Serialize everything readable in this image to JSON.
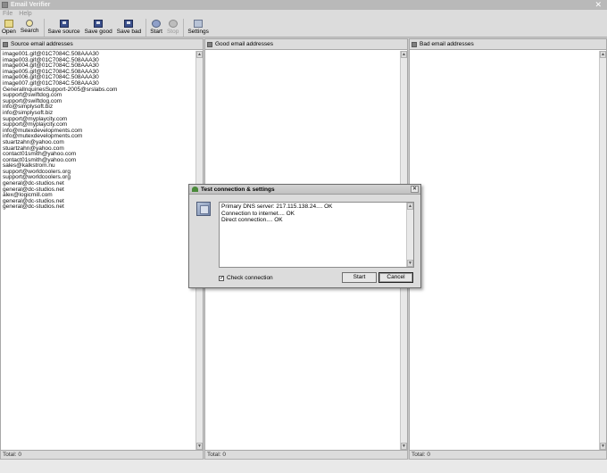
{
  "window": {
    "title": "Email Verifier"
  },
  "menu": [
    "File",
    "Help"
  ],
  "toolbar": [
    {
      "label": "Open",
      "icon": "open-icon",
      "enabled": true
    },
    {
      "label": "Search",
      "icon": "search-icon",
      "enabled": true
    },
    {
      "label": "Save source",
      "icon": "save-icon",
      "enabled": true
    },
    {
      "label": "Save good",
      "icon": "save-icon",
      "enabled": true
    },
    {
      "label": "Save bad",
      "icon": "save-icon",
      "enabled": true
    },
    {
      "label": "Start",
      "icon": "start-icon",
      "enabled": true
    },
    {
      "label": "Stop",
      "icon": "stop-icon",
      "enabled": false
    },
    {
      "label": "Settings",
      "icon": "settings-icon",
      "enabled": true
    }
  ],
  "panes": {
    "source": {
      "title": "Source email addresses",
      "items": [
        "image001.gif@01C7084C.508AAA30",
        "image003.gif@01C7084C.508AAA30",
        "image004.gif@01C7084C.508AAA30",
        "image005.gif@01C7084C.508AAA30",
        "image006.gif@01C7084C.508AAA30",
        "image007.gif@01C7084C.508AAA30",
        "GeneralInquiriesSupport-2005@srslabs.com",
        "support@swiftdog.com",
        "support@swiftdog.com",
        "info@simplysoft.biz",
        "info@simplysoft.biz",
        "support@myplaycity.com",
        "support@myplaycity.com",
        "info@mutexdevelopments.com",
        "info@mutexdevelopments.com",
        "stuartzahn@yahoo.com",
        "stuartzahn@yahoo.com",
        "contact01smith@yahoo.com",
        "contact01smith@yahoo.com",
        "sales@kalkstrom.nu",
        "support@worldcoolers.org",
        "support@worldcoolers.org",
        "general@dc-studios.net",
        "general@dc-studios.net",
        "alex@logicmill.com",
        "general@dc-studios.net",
        "general@dc-studios.net"
      ],
      "status": "Total: 0"
    },
    "good": {
      "title": "Good email addresses",
      "items": [],
      "status": "Total: 0"
    },
    "bad": {
      "title": "Bad email addresses",
      "items": [],
      "status": "Total: 0"
    }
  },
  "dialog": {
    "title": "Test connection & settings",
    "log": [
      "Primary DNS server: 217.115.138.24.... OK",
      "Connection to internet.... OK",
      "Direct connection.... OK"
    ],
    "check_label": "Check connection",
    "checked": true,
    "start_label": "Start",
    "cancel_label": "Cancel"
  }
}
